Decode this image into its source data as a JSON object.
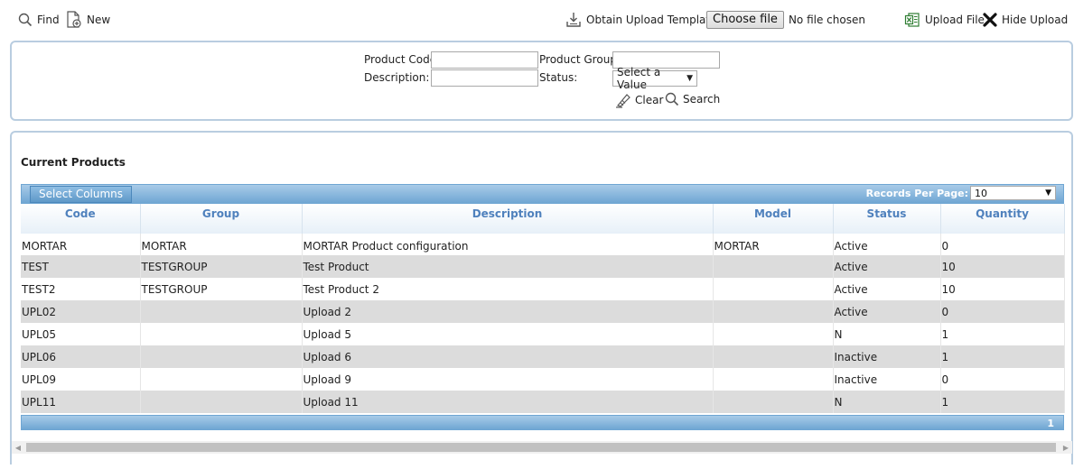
{
  "toolbar": {
    "find_label": "Find",
    "new_label": "New",
    "template_label": "Obtain Upload Template",
    "choose_file_label": "Choose file",
    "file_status": "No file chosen",
    "upload_label": "Upload File",
    "hide_upload_label": "Hide Upload"
  },
  "search": {
    "product_code_label": "Product Code:",
    "product_code_value": "",
    "product_group_label": "Product Group:",
    "product_group_value": "",
    "description_label": "Description:",
    "description_value": "",
    "status_label": "Status:",
    "status_value": "Select a Value",
    "clear_label": "Clear",
    "search_label": "Search"
  },
  "results": {
    "title": "Current Products",
    "select_columns_label": "Select Columns",
    "records_per_page_label": "Records Per Page:",
    "records_per_page_value": "10",
    "current_page": "1",
    "columns": [
      "Code",
      "Group",
      "Description",
      "Model",
      "Status",
      "Quantity"
    ],
    "rows": [
      [
        "MORTAR",
        "MORTAR",
        "MORTAR Product configuration",
        "MORTAR",
        "Active",
        "0"
      ],
      [
        "TEST",
        "TESTGROUP",
        "Test Product",
        "",
        "Active",
        "10"
      ],
      [
        "TEST2",
        "TESTGROUP",
        "Test Product 2",
        "",
        "Active",
        "10"
      ],
      [
        "UPL02",
        "",
        "Upload 2",
        "",
        "Active",
        "0"
      ],
      [
        "UPL05",
        "",
        "Upload 5",
        "",
        "N",
        "1"
      ],
      [
        "UPL06",
        "",
        "Upload 6",
        "",
        "Inactive",
        "1"
      ],
      [
        "UPL09",
        "",
        "Upload 9",
        "",
        "Inactive",
        "0"
      ],
      [
        "UPL11",
        "",
        "Upload 11",
        "",
        "N",
        "1"
      ]
    ]
  },
  "colors": {
    "panel_border": "#b9cde0",
    "grid_header_text": "#4f81bd",
    "grid_bar": "#6fa6d3",
    "alt_row": "#dcdcdc"
  }
}
